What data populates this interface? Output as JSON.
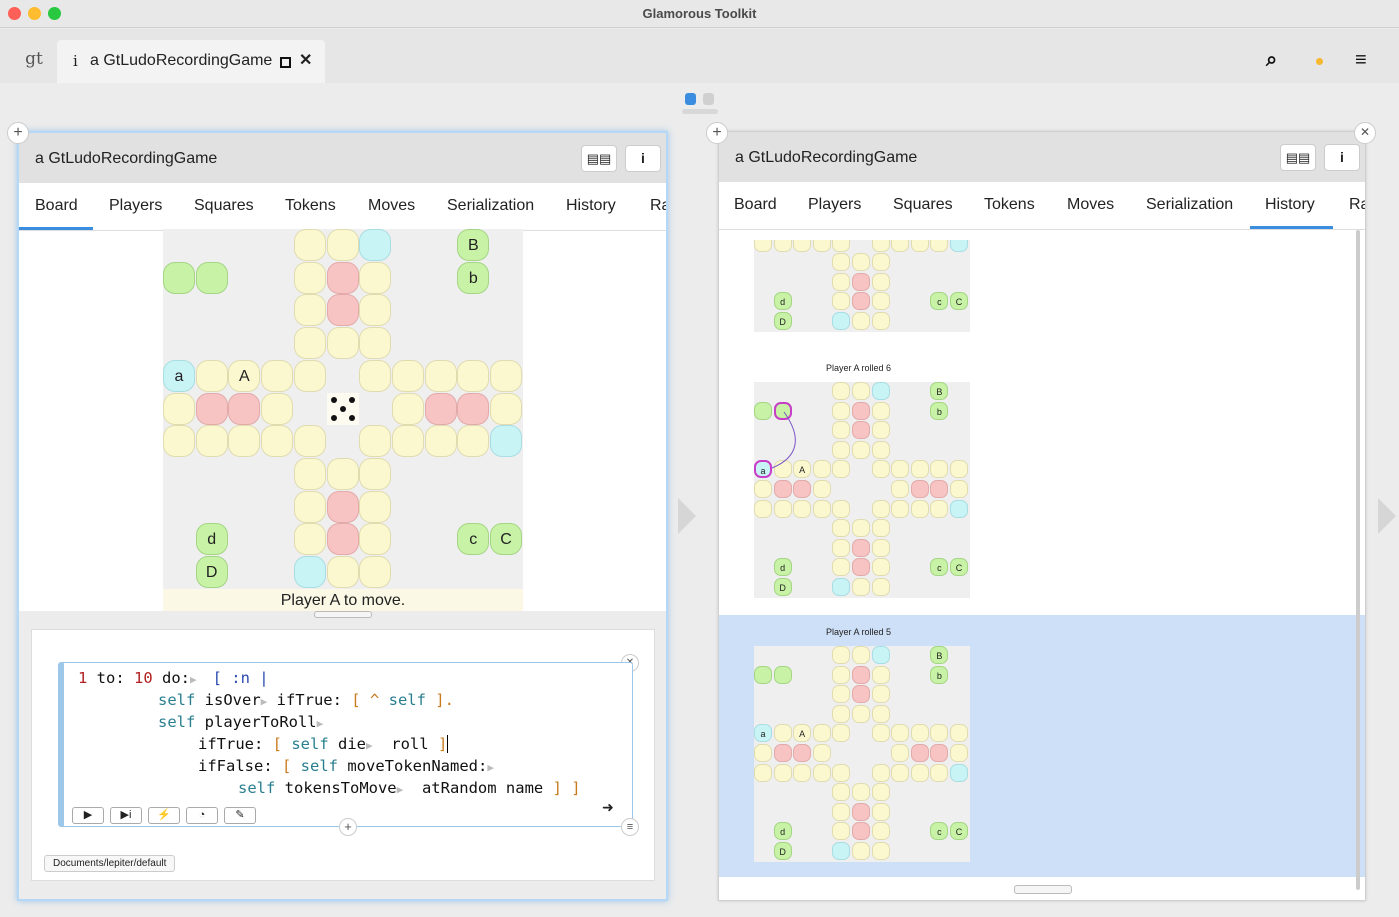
{
  "window": {
    "title": "Glamorous Toolkit"
  },
  "tabbar": {
    "logo": "gt",
    "tab_icon": "i",
    "tab_label": "a GtLudoRecordingGame",
    "tab_close": "✕",
    "search_icon": "⌕",
    "status_dot_color": "#f5b82e",
    "menu_icon": "≡"
  },
  "pager": {
    "active_color": "#3b8de0",
    "inactive_color": "#d0d0d0"
  },
  "left_pane": {
    "title": "a GtLudoRecordingGame",
    "book_button": "📖",
    "info_button": "i",
    "add_button": "+",
    "tabs": [
      "Board",
      "Players",
      "Squares",
      "Tokens",
      "Moves",
      "Serialization",
      "History",
      "Ra"
    ],
    "active_tab": "Board",
    "board": {
      "die_value": 5,
      "tokens": {
        "a": "a",
        "A": "A",
        "b": "b",
        "B": "B",
        "c": "c",
        "C": "C",
        "d": "d",
        "D": "D"
      }
    },
    "status": "Player A to move.",
    "snippet": {
      "close": "✕",
      "code": {
        "l1a": "1",
        "l1b": " to: ",
        "l1c": "10",
        "l1d": " do:",
        "l1e": "[ :n |",
        "l2a": "self",
        "l2b": " isOver",
        "l2c": " ifTrue: ",
        "l2d": "[ ^ ",
        "l2e": "self",
        "l2f": " ].",
        "l3a": "self",
        "l3b": " playerToRoll",
        "l4a": "ifTrue: ",
        "l4b": "[ ",
        "l4c": "self",
        "l4d": " die",
        "l4e": "  roll ",
        "l4f": "]",
        "l5a": "ifFalse: ",
        "l5b": "[ ",
        "l5c": "self",
        "l5d": " moveTokenNamed:",
        "l6a": "self",
        "l6b": " tokensToMove",
        "l6c": "  atRandom name ",
        "l6d": "] ]"
      },
      "arrow": "➜",
      "add": "+",
      "menu": "≡",
      "run_buttons": [
        "▶",
        "▶i",
        "⚡",
        "◔",
        "✎"
      ],
      "database": "Documents/lepiter/default"
    }
  },
  "right_pane": {
    "title": "a GtLudoRecordingGame",
    "book_button": "📖",
    "info_button": "i",
    "add_button": "+",
    "close_button": "✕",
    "tabs": [
      "Board",
      "Players",
      "Squares",
      "Tokens",
      "Moves",
      "Serialization",
      "History",
      "Ra"
    ],
    "active_tab": "History",
    "history": [
      {
        "title": ""
      },
      {
        "title": "Player A rolled 6"
      },
      {
        "title": "Player A rolled 5"
      }
    ],
    "mini_tokens": {
      "a": "a",
      "A": "A",
      "b": "b",
      "B": "B",
      "c": "c",
      "C": "C",
      "d": "d",
      "D": "D"
    }
  },
  "colors": {
    "yellow": "#fbf8cf",
    "red": "#f7c3c3",
    "cyan": "#c9f4f6",
    "green": "#c8f3a6",
    "selection": "#cde0f7",
    "accent": "#3b8de0"
  }
}
